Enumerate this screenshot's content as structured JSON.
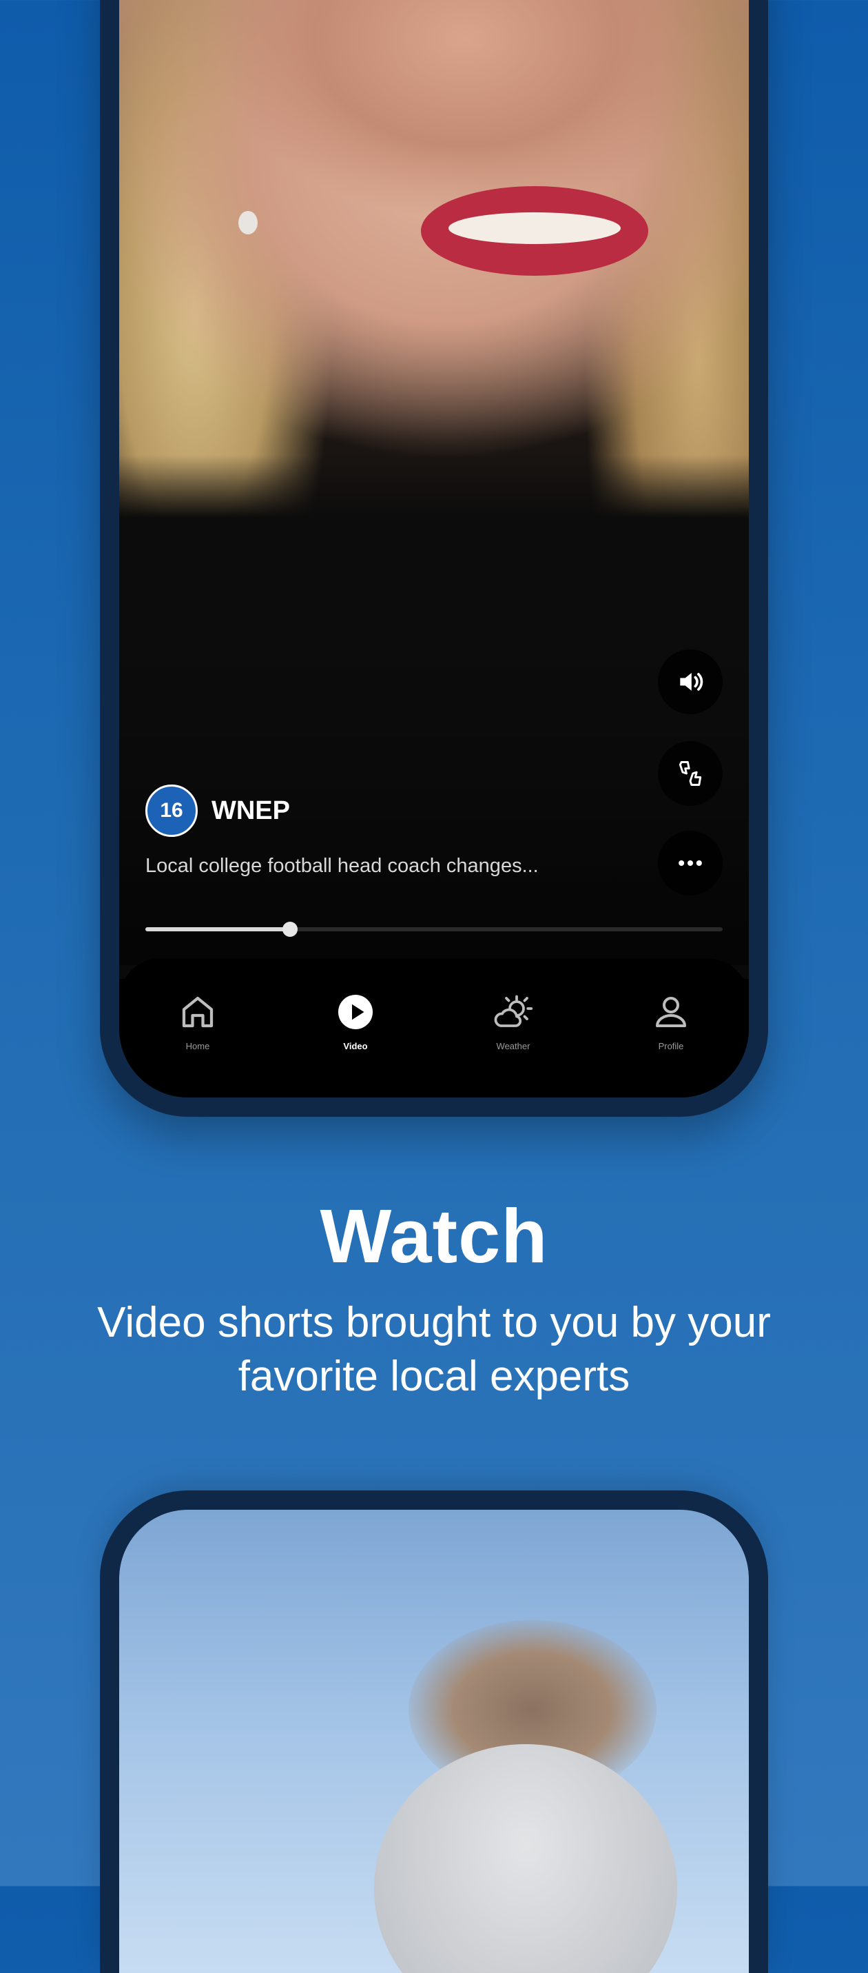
{
  "top_phone": {
    "channel": {
      "name": "WNEP",
      "logo_text": "16"
    },
    "caption": "Local college football head coach changes...",
    "progress_fraction": 0.25,
    "side_actions": [
      {
        "name": "volume-icon"
      },
      {
        "name": "thumbs-icon"
      },
      {
        "name": "more-icon"
      }
    ],
    "tabs": [
      {
        "label": "Home",
        "icon": "home-icon",
        "active": false
      },
      {
        "label": "Video",
        "icon": "play-icon",
        "active": true
      },
      {
        "label": "Weather",
        "icon": "weather-icon",
        "active": false
      },
      {
        "label": "Profile",
        "icon": "profile-icon",
        "active": false
      }
    ]
  },
  "marketing": {
    "headline": "Watch",
    "subline": "Video shorts brought to you by your favorite local experts"
  },
  "colors": {
    "background_top": "#0f5cab",
    "background_bottom": "#3278bd",
    "phone_frame": "#0f2847",
    "channel_logo": "#1c62b6"
  }
}
